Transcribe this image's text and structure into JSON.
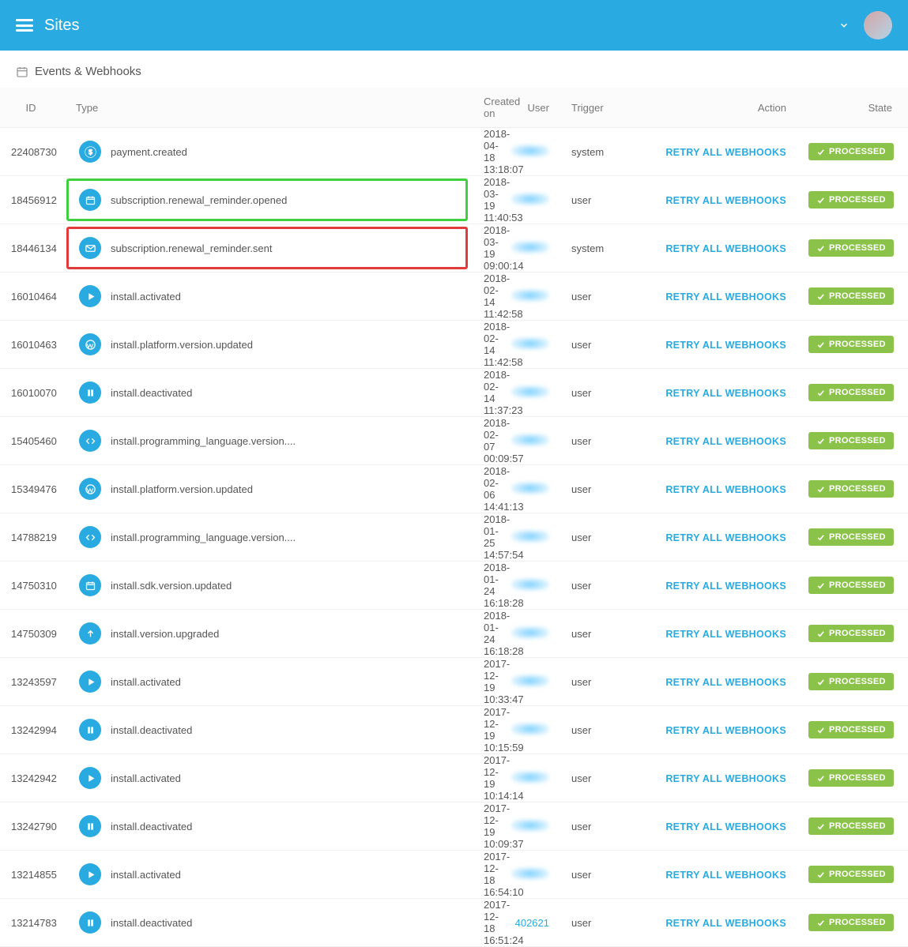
{
  "header": {
    "title": "Sites"
  },
  "subhead": {
    "title": "Events & Webhooks"
  },
  "columns": {
    "id": "ID",
    "type": "Type",
    "created": "Created on",
    "user": "User",
    "trigger": "Trigger",
    "action": "Action",
    "state": "State"
  },
  "action_label": "RETRY ALL WEBHOOKS",
  "state_label": "PROCESSED",
  "rows": [
    {
      "id": "22408730",
      "icon": "dollar",
      "type": "payment.created",
      "created": "2018-04-18 13:18:07",
      "user_blur": true,
      "user": "",
      "trigger": "system",
      "highlight": ""
    },
    {
      "id": "18456912",
      "icon": "calendar",
      "type": "subscription.renewal_reminder.opened",
      "created": "2018-03-19 11:40:53",
      "user_blur": true,
      "user": "",
      "trigger": "user",
      "highlight": "green"
    },
    {
      "id": "18446134",
      "icon": "envelope",
      "type": "subscription.renewal_reminder.sent",
      "created": "2018-03-19 09:00:14",
      "user_blur": true,
      "user": "",
      "trigger": "system",
      "highlight": "red"
    },
    {
      "id": "16010464",
      "icon": "play",
      "type": "install.activated",
      "created": "2018-02-14 11:42:58",
      "user_blur": true,
      "user": "",
      "trigger": "user",
      "highlight": ""
    },
    {
      "id": "16010463",
      "icon": "wordpress",
      "type": "install.platform.version.updated",
      "created": "2018-02-14 11:42:58",
      "user_blur": true,
      "user": "",
      "trigger": "user",
      "highlight": ""
    },
    {
      "id": "16010070",
      "icon": "pause",
      "type": "install.deactivated",
      "created": "2018-02-14 11:37:23",
      "user_blur": true,
      "user": "",
      "trigger": "user",
      "highlight": ""
    },
    {
      "id": "15405460",
      "icon": "code",
      "type": "install.programming_language.version....",
      "created": "2018-02-07 00:09:57",
      "user_blur": true,
      "user": "",
      "trigger": "user",
      "highlight": ""
    },
    {
      "id": "15349476",
      "icon": "wordpress",
      "type": "install.platform.version.updated",
      "created": "2018-02-06 14:41:13",
      "user_blur": true,
      "user": "",
      "trigger": "user",
      "highlight": ""
    },
    {
      "id": "14788219",
      "icon": "code",
      "type": "install.programming_language.version....",
      "created": "2018-01-25 14:57:54",
      "user_blur": true,
      "user": "",
      "trigger": "user",
      "highlight": ""
    },
    {
      "id": "14750310",
      "icon": "calendar",
      "type": "install.sdk.version.updated",
      "created": "2018-01-24 16:18:28",
      "user_blur": true,
      "user": "",
      "trigger": "user",
      "highlight": ""
    },
    {
      "id": "14750309",
      "icon": "upload",
      "type": "install.version.upgraded",
      "created": "2018-01-24 16:18:28",
      "user_blur": true,
      "user": "",
      "trigger": "user",
      "highlight": ""
    },
    {
      "id": "13243597",
      "icon": "play",
      "type": "install.activated",
      "created": "2017-12-19 10:33:47",
      "user_blur": true,
      "user": "",
      "trigger": "user",
      "highlight": ""
    },
    {
      "id": "13242994",
      "icon": "pause",
      "type": "install.deactivated",
      "created": "2017-12-19 10:15:59",
      "user_blur": true,
      "user": "",
      "trigger": "user",
      "highlight": ""
    },
    {
      "id": "13242942",
      "icon": "play",
      "type": "install.activated",
      "created": "2017-12-19 10:14:14",
      "user_blur": true,
      "user": "",
      "trigger": "user",
      "highlight": ""
    },
    {
      "id": "13242790",
      "icon": "pause",
      "type": "install.deactivated",
      "created": "2017-12-19 10:09:37",
      "user_blur": true,
      "user": "",
      "trigger": "user",
      "highlight": ""
    },
    {
      "id": "13214855",
      "icon": "play",
      "type": "install.activated",
      "created": "2017-12-18 16:54:10",
      "user_blur": true,
      "user": "",
      "trigger": "user",
      "highlight": ""
    },
    {
      "id": "13214783",
      "icon": "pause",
      "type": "install.deactivated",
      "created": "2017-12-18 16:51:24",
      "user_blur": false,
      "user": "402621",
      "trigger": "user",
      "highlight": ""
    }
  ]
}
